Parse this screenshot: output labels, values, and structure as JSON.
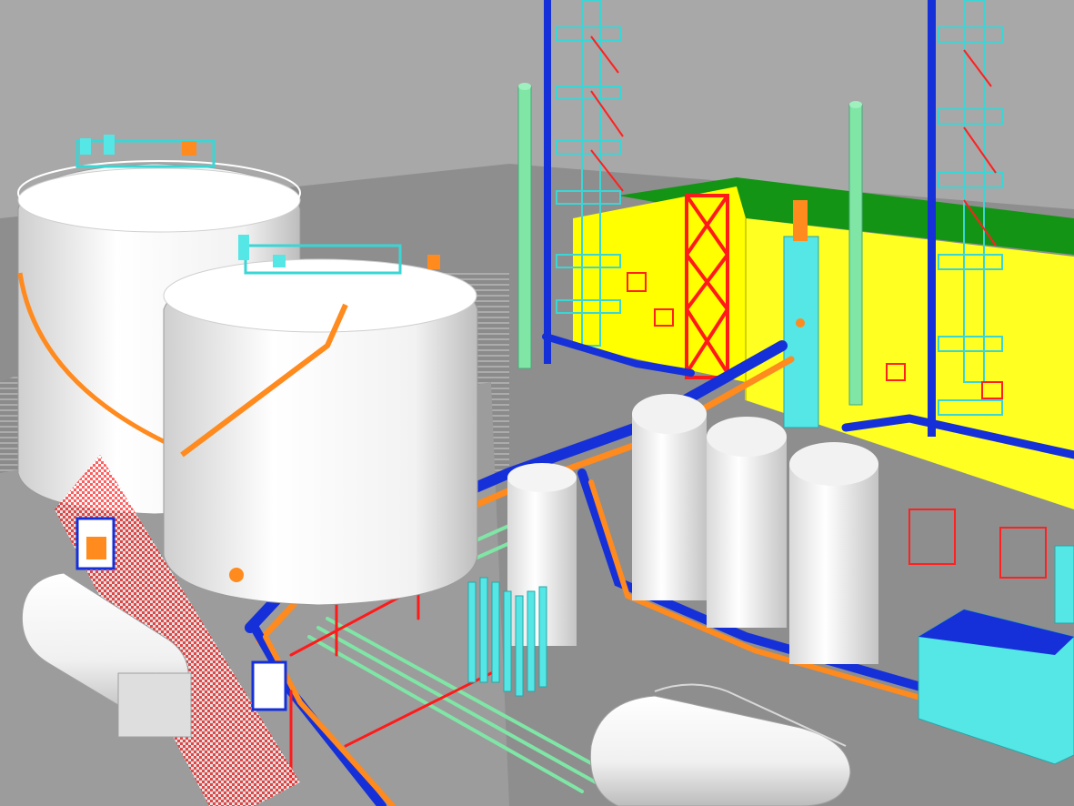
{
  "scene": {
    "type": "3d-plant-model-render",
    "palette": {
      "sky": "#a6a6a6",
      "ground": "#8c8c8c",
      "vessel": "#ffffff",
      "vessel_shade": "#d6d6d6",
      "structural_steel": "#ff1a1a",
      "main_pipe": "#1530d8",
      "orange_pipe": "#ff8a1e",
      "green_pipe": "#7fe6a6",
      "cyan_equipment": "#55e6e6",
      "building_wall": "#ffff00",
      "building_roof": "#149414",
      "tank_stair": "#ff8a1e"
    },
    "components": [
      "storage-tank",
      "process-column",
      "pipe-rack",
      "vertical-vessel",
      "horizontal-vessel",
      "stack",
      "process-building",
      "heat-exchanger"
    ]
  }
}
